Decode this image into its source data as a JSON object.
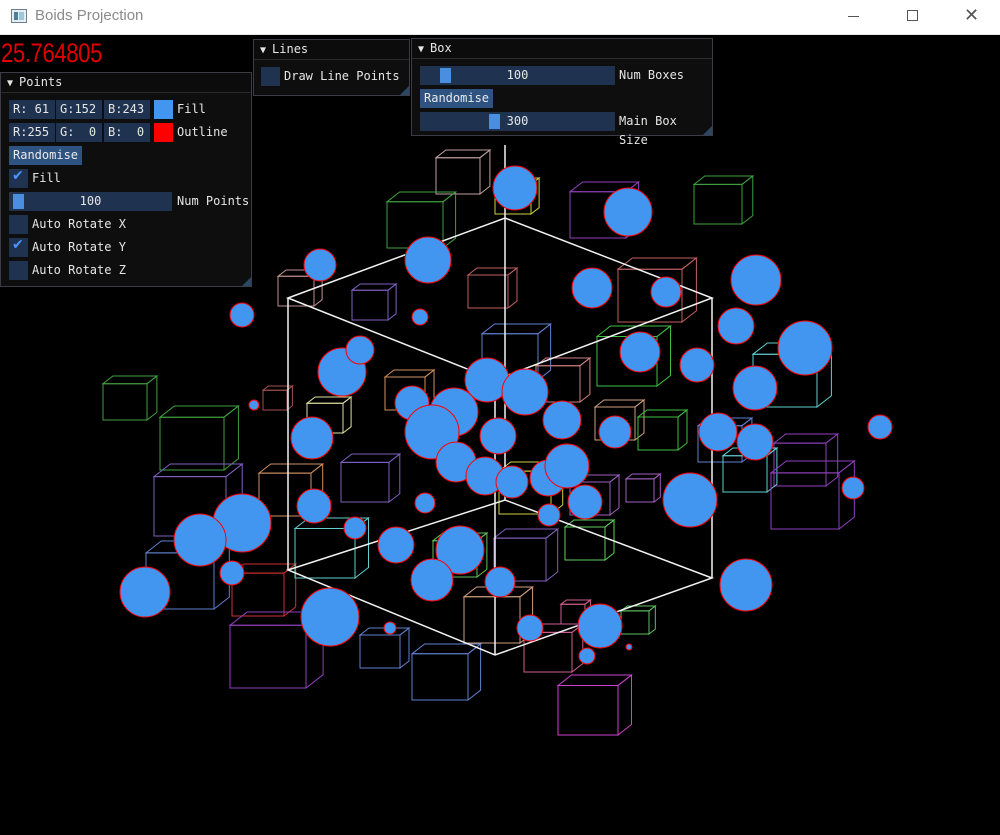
{
  "window": {
    "title": "Boids Projection",
    "minimize_glyph": "—",
    "close_glyph": "✕"
  },
  "fps_value": "25.764805",
  "colors": {
    "fill": "#4296f0",
    "outline": "#ff0000",
    "fps": "#e00000"
  },
  "points_panel": {
    "header": "Points",
    "fill_rgb": {
      "r": "R: 61",
      "g": "G:152",
      "b": "B:243",
      "label": "Fill"
    },
    "outline_rgb": {
      "r": "R:255",
      "g": "G:  0",
      "b": "B:  0",
      "label": "Outline"
    },
    "randomise_label": "Randomise",
    "fill_checkbox": {
      "label": "Fill",
      "checked": true
    },
    "num_points": {
      "value": "100",
      "label": "Num Points",
      "fraction": 0.05
    },
    "auto_rotate_x": {
      "label": "Auto Rotate X",
      "checked": false
    },
    "auto_rotate_y": {
      "label": "Auto Rotate Y",
      "checked": true
    },
    "auto_rotate_z": {
      "label": "Auto Rotate Z",
      "checked": false
    }
  },
  "lines_panel": {
    "header": "Lines",
    "draw_line_points": {
      "label": "Draw Line Points",
      "checked": false
    }
  },
  "box_panel": {
    "header": "Box",
    "num_boxes": {
      "value": "100",
      "label": "Num Boxes",
      "fraction": 0.1
    },
    "randomise_label": "Randomise",
    "main_box_size": {
      "value": "300",
      "label": "Main Box Size",
      "fraction": 0.5
    }
  }
}
